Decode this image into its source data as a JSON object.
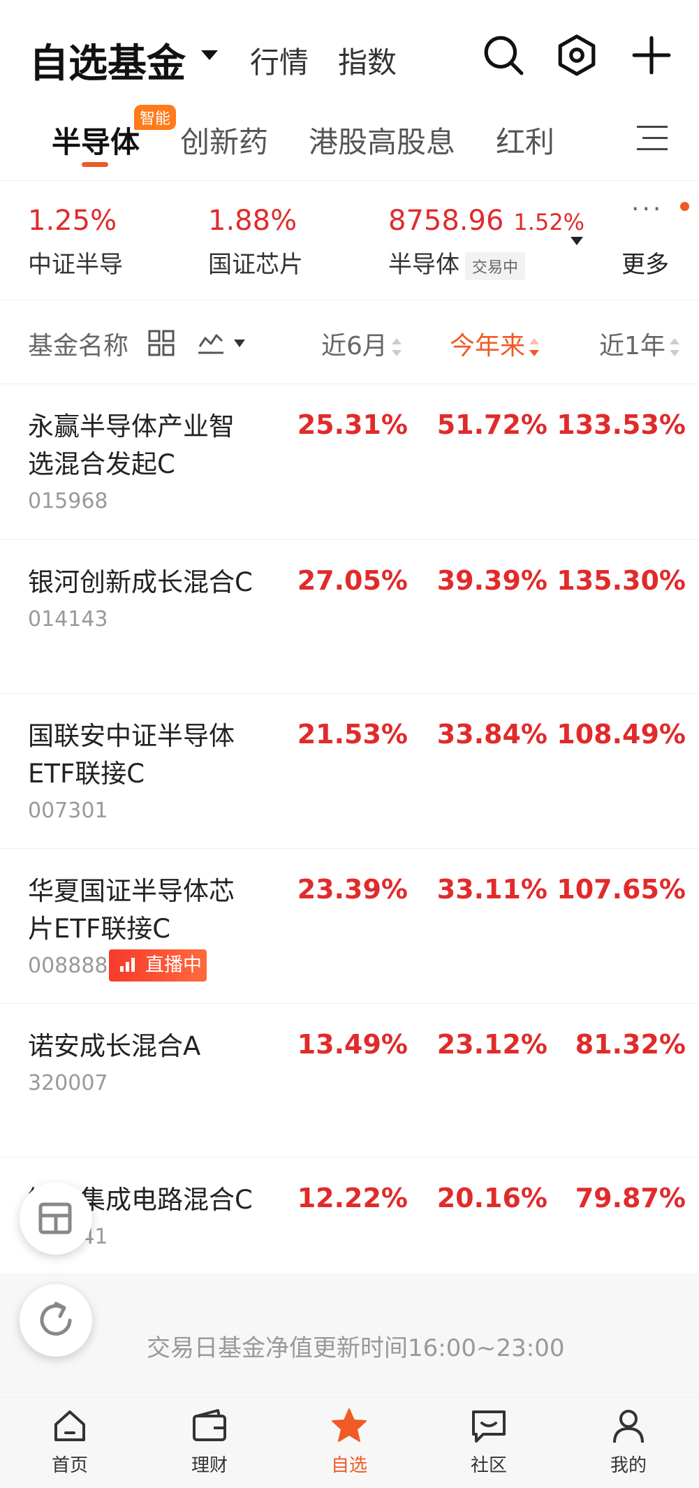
{
  "header": {
    "title": "自选基金",
    "links": [
      "行情",
      "指数"
    ],
    "icons": [
      "search-icon",
      "settings-icon",
      "add-icon"
    ]
  },
  "category_tabs": {
    "items": [
      "半导体",
      "创新药",
      "港股高股息",
      "红利"
    ],
    "active": "半导体",
    "badge": "智能"
  },
  "indices": [
    {
      "value": "1.25%",
      "name": "中证半导"
    },
    {
      "value": "1.88%",
      "name": "国证芯片"
    },
    {
      "value": "8758.96",
      "change": "1.52%",
      "name": "半导体",
      "tag": "交易中"
    }
  ],
  "more_label": "更多",
  "columns": {
    "name": "基金名称",
    "c1": "近6月",
    "c2": "今年来",
    "c3": "近1年",
    "sorted": "今年来"
  },
  "funds": [
    {
      "name": "永赢半导体产业智选混合发起C",
      "code": "015968",
      "m6": "25.31%",
      "ytd": "51.72%",
      "y1": "133.53%"
    },
    {
      "name": "银河创新成长混合C",
      "code": "014143",
      "m6": "27.05%",
      "ytd": "39.39%",
      "y1": "135.30%"
    },
    {
      "name": "国联安中证半导体ETF联接C",
      "code": "007301",
      "m6": "21.53%",
      "ytd": "33.84%",
      "y1": "108.49%"
    },
    {
      "name": "华夏国证半导体芯片ETF联接C",
      "code": "008888",
      "m6": "23.39%",
      "ytd": "33.11%",
      "y1": "107.65%",
      "live": "直播中"
    },
    {
      "name": "诺安成长混合A",
      "code": "320007",
      "m6": "13.49%",
      "ytd": "23.12%",
      "y1": "81.32%"
    },
    {
      "name": "银华集成电路混合C",
      "code": "013841",
      "m6": "12.22%",
      "ytd": "20.16%",
      "y1": "79.87%"
    }
  ],
  "footer_note": "交易日基金净值更新时间16:00~23:00",
  "bottom_nav": [
    {
      "label": "首页",
      "icon": "home-icon"
    },
    {
      "label": "理财",
      "icon": "wallet-icon"
    },
    {
      "label": "自选",
      "icon": "star-icon",
      "active": true
    },
    {
      "label": "社区",
      "icon": "chat-icon"
    },
    {
      "label": "我的",
      "icon": "user-icon"
    }
  ],
  "colors": {
    "accent": "#f05a24",
    "gain": "#e02b2b"
  }
}
